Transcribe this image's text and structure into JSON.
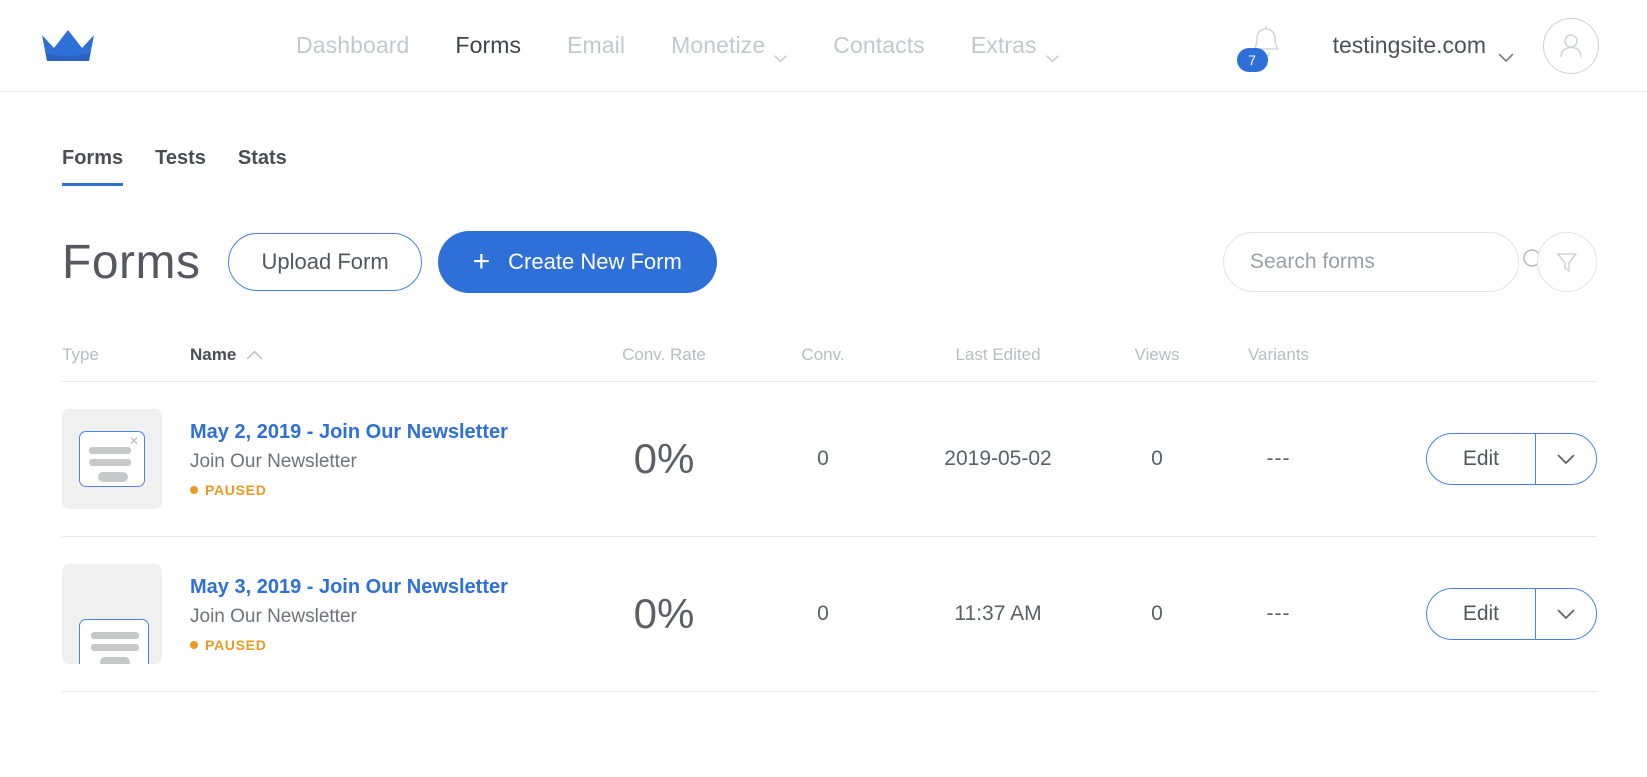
{
  "header": {
    "logo_icon": "crown-logo",
    "nav": [
      {
        "label": "Dashboard",
        "active": false,
        "has_caret": false
      },
      {
        "label": "Forms",
        "active": true,
        "has_caret": false
      },
      {
        "label": "Email",
        "active": false,
        "has_caret": false
      },
      {
        "label": "Monetize",
        "active": false,
        "has_caret": true
      },
      {
        "label": "Contacts",
        "active": false,
        "has_caret": false
      },
      {
        "label": "Extras",
        "active": false,
        "has_caret": true
      }
    ],
    "notification_count": "7",
    "site_name": "testingsite.com",
    "accent_color": "#2f6fd8"
  },
  "tabs": [
    {
      "label": "Forms",
      "active": true
    },
    {
      "label": "Tests",
      "active": false
    },
    {
      "label": "Stats",
      "active": false
    }
  ],
  "page": {
    "title": "Forms",
    "upload_label": "Upload Form",
    "create_label": "Create New Form",
    "create_icon": "plus-icon"
  },
  "search": {
    "placeholder": "Search forms",
    "value": "",
    "icon": "search-icon",
    "filter_icon": "filter-icon"
  },
  "table": {
    "columns": [
      {
        "key": "type",
        "label": "Type",
        "sorted": false
      },
      {
        "key": "name",
        "label": "Name",
        "sorted": true,
        "sort_dir": "asc"
      },
      {
        "key": "rate",
        "label": "Conv. Rate",
        "sorted": false
      },
      {
        "key": "conv",
        "label": "Conv.",
        "sorted": false
      },
      {
        "key": "edited",
        "label": "Last Edited",
        "sorted": false
      },
      {
        "key": "views",
        "label": "Views",
        "sorted": false
      },
      {
        "key": "variants",
        "label": "Variants",
        "sorted": false
      }
    ],
    "rows": [
      {
        "thumb_type": "popup-form-thumbnail",
        "name": "May 2, 2019 - Join Our Newsletter",
        "subtitle": "Join Our Newsletter",
        "status": "PAUSED",
        "status_color": "#e89a23",
        "rate": "0%",
        "conv": "0",
        "edited": "2019-05-02",
        "views": "0",
        "variants": "---",
        "edit_label": "Edit"
      },
      {
        "thumb_type": "bar-form-thumbnail",
        "name": "May 3, 2019 - Join Our Newsletter",
        "subtitle": "Join Our Newsletter",
        "status": "PAUSED",
        "status_color": "#e89a23",
        "rate": "0%",
        "conv": "0",
        "edited": "11:37 AM",
        "views": "0",
        "variants": "---",
        "edit_label": "Edit"
      }
    ]
  }
}
